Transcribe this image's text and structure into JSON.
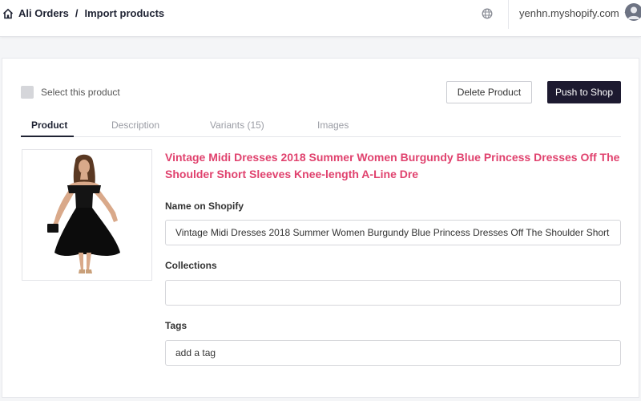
{
  "header": {
    "breadcrumbs": [
      "Ali Orders",
      "Import products"
    ],
    "separator": "/",
    "shop_domain": "yenhn.myshopify.com"
  },
  "actions": {
    "select_label": "Select this product",
    "delete_label": "Delete Product",
    "push_label": "Push to Shop"
  },
  "tabs": [
    {
      "label": "Product",
      "active": true
    },
    {
      "label": "Description",
      "active": false
    },
    {
      "label": "Variants (15)",
      "active": false
    },
    {
      "label": "Images",
      "active": false
    }
  ],
  "product": {
    "title": "Vintage Midi Dresses 2018 Summer Women Burgundy Blue Princess Dresses Off The Shoulder Short Sleeves Knee-length A-Line Dre",
    "name_label": "Name on Shopify",
    "name_value": "Vintage Midi Dresses 2018 Summer Women Burgundy Blue Princess Dresses Off The Shoulder Short Sleeves Kn",
    "collections_label": "Collections",
    "collections_value": "",
    "tags_label": "Tags",
    "tags_placeholder": "add a tag"
  },
  "colors": {
    "accent": "#e0426e",
    "primary_button": "#1d1a30"
  }
}
